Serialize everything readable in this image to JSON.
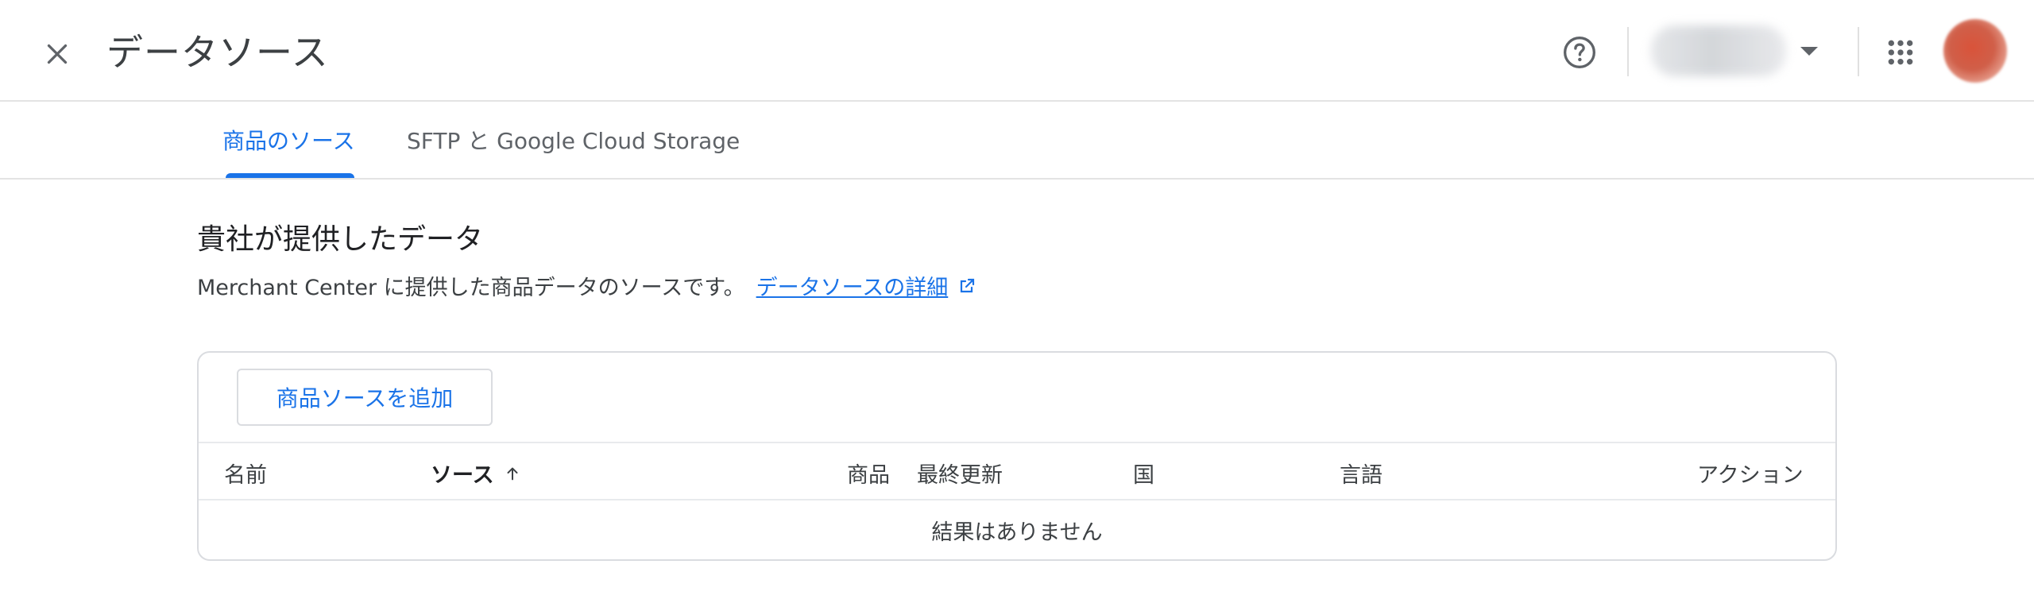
{
  "header": {
    "title": "データソース"
  },
  "tabs": [
    {
      "label": "商品のソース",
      "active": true
    },
    {
      "label": "SFTP と Google Cloud Storage",
      "active": false
    }
  ],
  "section": {
    "title": "貴社が提供したデータ",
    "description": "Merchant Center に提供した商品データのソースです。",
    "link_label": "データソースの詳細"
  },
  "table": {
    "add_button_label": "商品ソースを追加",
    "columns": [
      {
        "label": "名前"
      },
      {
        "label": "ソース",
        "sorted": "ascending"
      },
      {
        "label": "商品"
      },
      {
        "label": "最終更新"
      },
      {
        "label": "国"
      },
      {
        "label": "言語"
      },
      {
        "label": "アクション"
      }
    ],
    "empty_message": "結果はありません"
  },
  "icons": {
    "close": "close-icon",
    "help": "help-circle-icon",
    "account_caret": "caret-down-icon",
    "apps": "apps-grid-icon",
    "external_link": "open-in-new-icon",
    "sort": "arrow-up-icon"
  },
  "colors": {
    "accent": "#1a73e8",
    "text": "#3c4043",
    "divider": "#dadce0"
  }
}
